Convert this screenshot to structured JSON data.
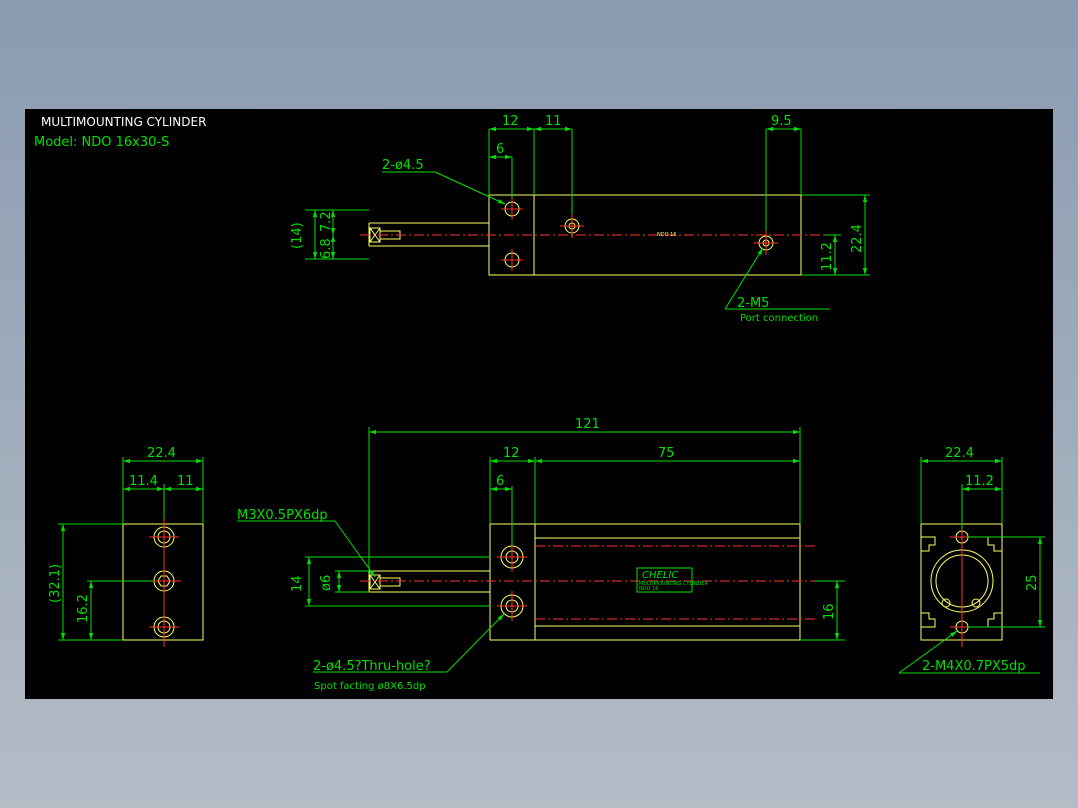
{
  "title": "MULTIMOUNTING CYLINDER",
  "model": "Model:  NDO 16x30-S",
  "top_view": {
    "dim_12": "12",
    "dim_11": "11",
    "dim_9_5": "9.5",
    "dim_6": "6",
    "hole_callout": "2-ø4.5",
    "dim_14": "(14)",
    "dim_6_8": "6.8",
    "dim_7_2": "7.2",
    "dim_11_2": "11.2",
    "dim_22_4": "22.4",
    "port_callout": "2-M5",
    "port_note": "Port connection",
    "body_label": "NDO 16"
  },
  "front_view": {
    "dim_121": "121",
    "dim_12": "12",
    "dim_75": "75",
    "dim_6": "6",
    "thread_callout": "M3X0.5PX6dp",
    "dim_14": "14",
    "dim_phi6": "ø6",
    "dim_16": "16",
    "hole_callout": "2-ø4.5?Thru-hole?",
    "spot_note": "Spot facting  ø8X6.5dp",
    "brand": "CHELIC",
    "plate_line1": "MULTIMOUNTING CYLINDER",
    "plate_line2": "NDO 16"
  },
  "left_view": {
    "dim_22_4": "22.4",
    "dim_11_4": "11.4",
    "dim_11": "11",
    "dim_32_1": "(32.1)",
    "dim_16_2": "16.2"
  },
  "right_view": {
    "dim_22_4": "22.4",
    "dim_11_2": "11.2",
    "dim_25": "25",
    "thread_callout": "2-M4X0.7PX5dp"
  }
}
